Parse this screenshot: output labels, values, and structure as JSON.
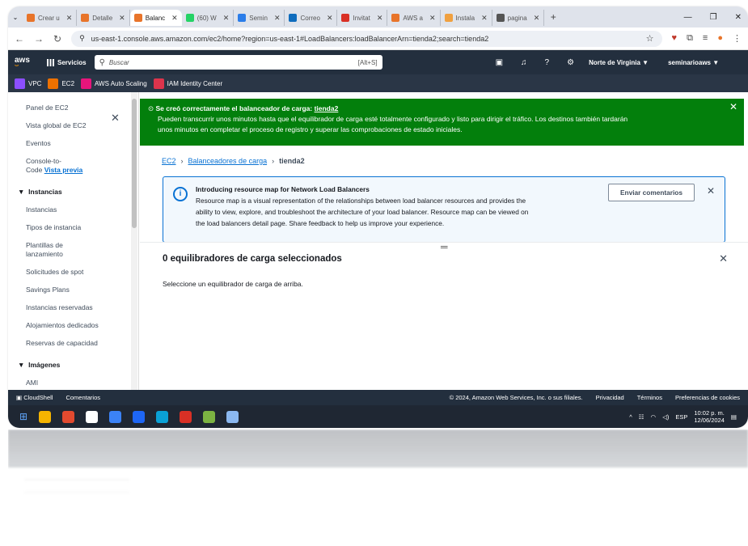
{
  "browser": {
    "tabs": [
      {
        "label": "Crear u",
        "active": false,
        "color": "#e8742a"
      },
      {
        "label": "Detalle",
        "active": false,
        "color": "#e8742a"
      },
      {
        "label": "Balanc",
        "active": true,
        "color": "#e8742a"
      },
      {
        "label": "(60) W",
        "active": false,
        "color": "#25d366"
      },
      {
        "label": "Semin",
        "active": false,
        "color": "#2b7de9"
      },
      {
        "label": "Correo",
        "active": false,
        "color": "#0f6cbd"
      },
      {
        "label": "Invitat",
        "active": false,
        "color": "#d93025"
      },
      {
        "label": "AWS a",
        "active": false,
        "color": "#e8742a"
      },
      {
        "label": "Instala",
        "active": false,
        "color": "#f0a040"
      },
      {
        "label": "pagina",
        "active": false,
        "color": "#555555"
      }
    ],
    "url": "us-east-1.console.aws.amazon.com/ec2/home?region=us-east-1#LoadBalancers:loadBalancerArn=tienda2;search=tienda2"
  },
  "aws": {
    "logo": "aws",
    "services": "Servicios",
    "search_placeholder": "Buscar",
    "search_shortcut": "[Alt+S]",
    "region": "Norte de Virginia ▼",
    "account": "seminarioaws ▼"
  },
  "favorites": [
    {
      "label": "VPC",
      "color": "#8c4fff"
    },
    {
      "label": "EC2",
      "color": "#ed7100"
    },
    {
      "label": "AWS Auto Scaling",
      "color": "#e7157b"
    },
    {
      "label": "IAM Identity Center",
      "color": "#dd344c"
    }
  ],
  "sidebar": {
    "items": [
      "Panel de EC2",
      "Vista global de EC2",
      "Eventos"
    ],
    "console": "Console-to-",
    "console2": "Code",
    "preview": "Vista previa",
    "section1": "Instancias",
    "instancias": [
      "Instancias",
      "Tipos de instancia"
    ],
    "plantillas1": "Plantillas de",
    "plantillas2": "lanzamiento",
    "more": [
      "Solicitudes de spot",
      "Savings Plans",
      "Instancias reservadas",
      "Alojamientos dedicados",
      "Reservas de capacidad"
    ],
    "section2": "Imágenes",
    "ami": "AMI"
  },
  "flash": {
    "title_prefix": "Se creó correctamente el balanceador de carga: ",
    "title_name": "tienda2",
    "line1": "Pueden transcurrir unos minutos hasta que el equilibrador de carga esté totalmente configurado y listo para dirigir el tráfico. Los destinos también tardarán",
    "line2": "unos minutos en completar el proceso de registro y superar las comprobaciones de estado iniciales."
  },
  "breadcrumb": {
    "ec2": "EC2",
    "lb": "Balanceadores de carga",
    "current": "tienda2"
  },
  "info": {
    "title": "Introducing resource map for Network Load Balancers",
    "l1": "Resource map is a visual representation of the relationships between load balancer resources and provides the",
    "l2": "ability to view, explore, and troubleshoot the architecture of your load balancer. Resource map can be viewed on",
    "l3": "the load balancers detail page. Share feedback to help us improve your experience.",
    "button": "Enviar comentarios"
  },
  "split": {
    "title": "0 equilibradores de carga seleccionados",
    "text": "Seleccione un equilibrador de carga de arriba."
  },
  "footer": {
    "cloudshell": "CloudShell",
    "comments": "Comentarios",
    "copyright": "© 2024, Amazon Web Services, Inc. o sus filiales.",
    "privacy": "Privacidad",
    "terms": "Términos",
    "cookies": "Preferencias de cookies"
  },
  "taskbar": {
    "apps": [
      "#f5b400",
      "#e24a2f",
      "#ffffff",
      "#3b82f6",
      "#1e66f5",
      "#0aa1d6",
      "#d93025",
      "#7cb342",
      "#8bb8f0"
    ],
    "lang": "ESP",
    "time": "10:02 p. m.",
    "date": "12/06/2024"
  }
}
